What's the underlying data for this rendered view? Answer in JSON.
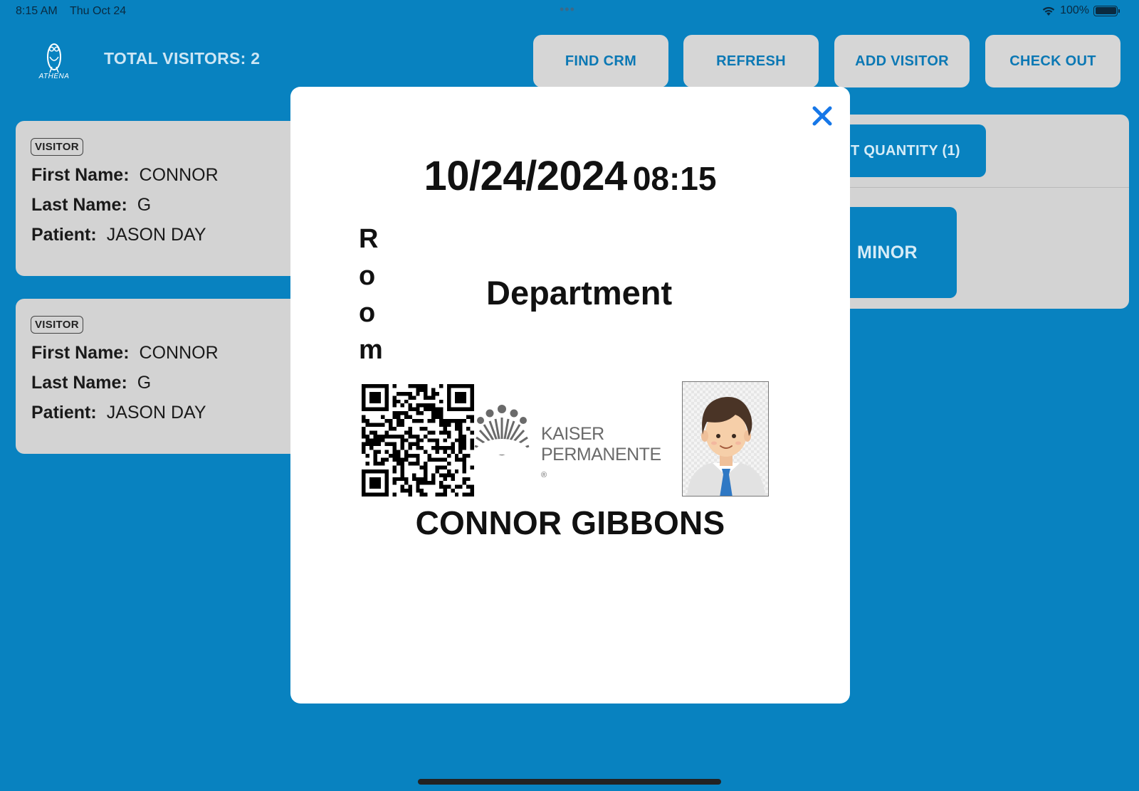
{
  "status_bar": {
    "time": "8:15 AM",
    "date": "Thu Oct 24",
    "battery": "100%",
    "icons": [
      "wifi-icon",
      "battery-icon"
    ]
  },
  "header": {
    "logo_text": "ATHENA",
    "total_visitors": "TOTAL VISITORS: 2",
    "buttons": {
      "find_crm": "FIND CRM",
      "refresh": "REFRESH",
      "add_visitor": "ADD VISITOR",
      "check_out": "CHECK OUT"
    }
  },
  "visitors": [
    {
      "badge": "VISITOR",
      "first_name_label": "First Name:",
      "first_name": "CONNOR",
      "last_name_label": "Last Name:",
      "last_name": "G",
      "patient_label": "Patient:",
      "patient": "JASON DAY"
    },
    {
      "badge": "VISITOR",
      "first_name_label": "First Name:",
      "first_name": "CONNOR",
      "last_name_label": "Last Name:",
      "last_name": "G",
      "patient_label": "Patient:",
      "patient": "JASON DAY"
    }
  ],
  "right_panel": {
    "quantity_label": "T QUANTITY (1)",
    "minor_label": "MINOR"
  },
  "badge_preview": {
    "date": "10/24/2024",
    "time": "08:15",
    "room": "Room",
    "department": "Department",
    "org_line1": "KAISER",
    "org_line2": "PERMANENTE",
    "org_reg": "®",
    "visitor_name": "CONNOR GIBBONS"
  },
  "colors": {
    "background": "#0882c0",
    "button_bg": "#d6d6d6",
    "button_text": "#0b78b4",
    "card_bg": "#d3d3d3",
    "close_icon": "#1677e8"
  }
}
